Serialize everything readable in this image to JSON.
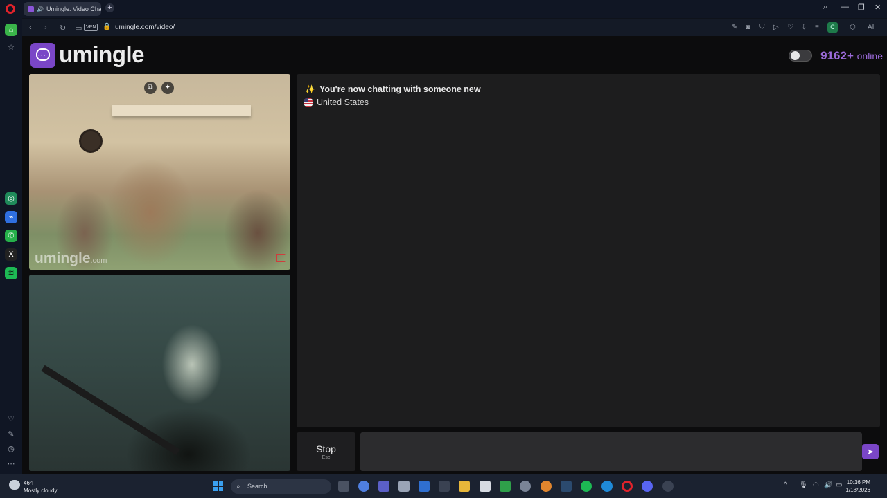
{
  "browser": {
    "tab_title": "Umingle: Video Chat",
    "url": "umingle.com/video/",
    "vpn_label": "VPN",
    "ext_label": "C",
    "ai_label": "AI"
  },
  "brand": {
    "name": "umingle",
    "accent": "#7a46c7"
  },
  "online": {
    "count": "9162+",
    "label": "online"
  },
  "stranger_video": {
    "watermark": "umingle",
    "watermark_suffix": ".com"
  },
  "chat": {
    "status": "You're now chatting with someone new",
    "country": "United States"
  },
  "controls": {
    "stop_label": "Stop",
    "stop_hint": "Esc",
    "message_value": ""
  },
  "taskbar": {
    "weather_temp": "46°F",
    "weather_desc": "Mostly cloudy",
    "search_label": "Search",
    "time": "10:16 PM",
    "date": "1/18/2026"
  },
  "icons": {
    "opera": "opera-logo-icon",
    "send": "send-arrow-icon",
    "sparkle": "sparkles-icon"
  }
}
